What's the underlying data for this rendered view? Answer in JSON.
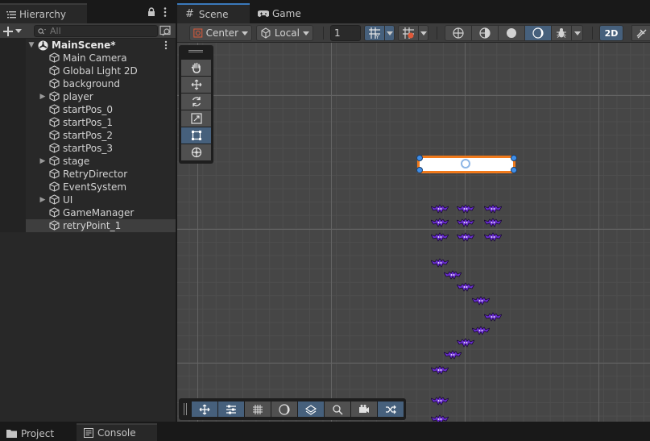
{
  "hierarchy": {
    "tab_label": "Hierarchy",
    "search_placeholder": "All",
    "scene_name": "MainScene*",
    "items": [
      {
        "label": "Main Camera",
        "expandable": false,
        "selected": false
      },
      {
        "label": "Global Light 2D",
        "expandable": false,
        "selected": false
      },
      {
        "label": "background",
        "expandable": false,
        "selected": false
      },
      {
        "label": "player",
        "expandable": true,
        "selected": false
      },
      {
        "label": "startPos_0",
        "expandable": false,
        "selected": false
      },
      {
        "label": "startPos_1",
        "expandable": false,
        "selected": false
      },
      {
        "label": "startPos_2",
        "expandable": false,
        "selected": false
      },
      {
        "label": "startPos_3",
        "expandable": false,
        "selected": false
      },
      {
        "label": "stage",
        "expandable": true,
        "selected": false
      },
      {
        "label": "RetryDirector",
        "expandable": false,
        "selected": false
      },
      {
        "label": "EventSystem",
        "expandable": false,
        "selected": false
      },
      {
        "label": "UI",
        "expandable": true,
        "selected": false
      },
      {
        "label": "GameManager",
        "expandable": false,
        "selected": false
      },
      {
        "label": "retryPoint_1",
        "expandable": false,
        "selected": true
      }
    ]
  },
  "scene": {
    "tabs": [
      {
        "label": "Scene",
        "active": true
      },
      {
        "label": "Game",
        "active": false
      }
    ],
    "toolbar": {
      "pivot_mode": "Center",
      "pivot_rotation": "Local",
      "grid_size": "1",
      "view_mode": "2D"
    },
    "tools": [
      "hand-icon",
      "move-icon",
      "rotate-icon",
      "scale-icon",
      "rect-icon",
      "transform-icon"
    ],
    "active_tool": "rect-icon"
  },
  "bottom_tabs": [
    {
      "label": "Project",
      "active": false
    },
    {
      "label": "Console",
      "active": true
    }
  ],
  "colors": {
    "accent": "#3a79bb",
    "selection_outline": "#f07a1c",
    "handle": "#3f8ee8",
    "bat_sprite": "#6b2fd1"
  }
}
